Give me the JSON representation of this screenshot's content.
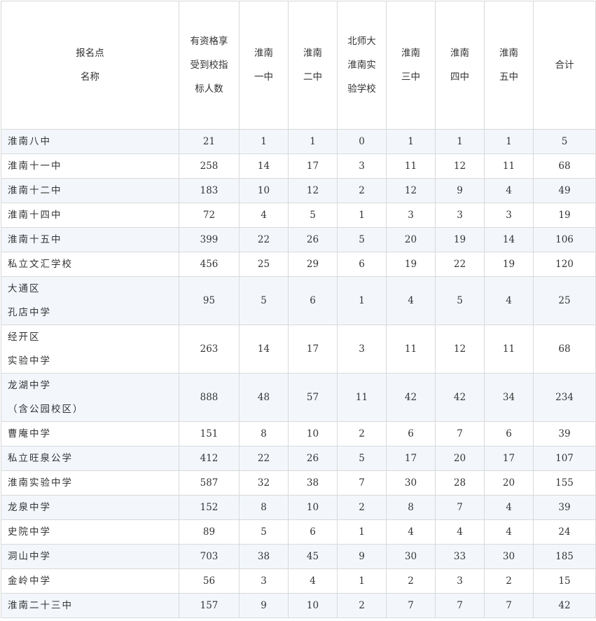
{
  "headers": [
    [
      "报名点",
      "名称"
    ],
    [
      "有资格享",
      "受到校指",
      "标人数"
    ],
    [
      "淮南",
      "一中"
    ],
    [
      "淮南",
      "二中"
    ],
    [
      "北师大",
      "淮南实",
      "验学校"
    ],
    [
      "淮南",
      "三中"
    ],
    [
      "淮南",
      "四中"
    ],
    [
      "淮南",
      "五中"
    ],
    [
      "合计"
    ]
  ],
  "rows": [
    {
      "name": [
        "淮南八中"
      ],
      "cells": [
        "21",
        "1",
        "1",
        "0",
        "1",
        "1",
        "1",
        "5"
      ]
    },
    {
      "name": [
        "淮南十一中"
      ],
      "cells": [
        "258",
        "14",
        "17",
        "3",
        "11",
        "12",
        "11",
        "68"
      ]
    },
    {
      "name": [
        "淮南十二中"
      ],
      "cells": [
        "183",
        "10",
        "12",
        "2",
        "12",
        "9",
        "4",
        "49"
      ]
    },
    {
      "name": [
        "淮南十四中"
      ],
      "cells": [
        "72",
        "4",
        "5",
        "1",
        "3",
        "3",
        "3",
        "19"
      ]
    },
    {
      "name": [
        "淮南十五中"
      ],
      "cells": [
        "399",
        "22",
        "26",
        "5",
        "20",
        "19",
        "14",
        "106"
      ]
    },
    {
      "name": [
        "私立文汇学校"
      ],
      "cells": [
        "456",
        "25",
        "29",
        "6",
        "19",
        "22",
        "19",
        "120"
      ]
    },
    {
      "name": [
        "大通区",
        "孔店中学"
      ],
      "cells": [
        "95",
        "5",
        "6",
        "1",
        "4",
        "5",
        "4",
        "25"
      ]
    },
    {
      "name": [
        "经开区",
        "实验中学"
      ],
      "cells": [
        "263",
        "14",
        "17",
        "3",
        "11",
        "12",
        "11",
        "68"
      ]
    },
    {
      "name": [
        "龙湖中学",
        "（含公园校区）"
      ],
      "cells": [
        "888",
        "48",
        "57",
        "11",
        "42",
        "42",
        "34",
        "234"
      ]
    },
    {
      "name": [
        "曹庵中学"
      ],
      "cells": [
        "151",
        "8",
        "10",
        "2",
        "6",
        "7",
        "6",
        "39"
      ]
    },
    {
      "name": [
        "私立旺泉公学"
      ],
      "cells": [
        "412",
        "22",
        "26",
        "5",
        "17",
        "20",
        "17",
        "107"
      ]
    },
    {
      "name": [
        "淮南实验中学"
      ],
      "cells": [
        "587",
        "32",
        "38",
        "7",
        "30",
        "28",
        "20",
        "155"
      ]
    },
    {
      "name": [
        "龙泉中学"
      ],
      "cells": [
        "152",
        "8",
        "10",
        "2",
        "8",
        "7",
        "4",
        "39"
      ]
    },
    {
      "name": [
        "史院中学"
      ],
      "cells": [
        "89",
        "5",
        "6",
        "1",
        "4",
        "4",
        "4",
        "24"
      ]
    },
    {
      "name": [
        "洞山中学"
      ],
      "cells": [
        "703",
        "38",
        "45",
        "9",
        "30",
        "33",
        "30",
        "185"
      ]
    },
    {
      "name": [
        "金岭中学"
      ],
      "cells": [
        "56",
        "3",
        "4",
        "1",
        "2",
        "3",
        "2",
        "15"
      ]
    },
    {
      "name": [
        "淮南二十三中"
      ],
      "cells": [
        "157",
        "9",
        "10",
        "2",
        "7",
        "7",
        "7",
        "42"
      ]
    }
  ]
}
